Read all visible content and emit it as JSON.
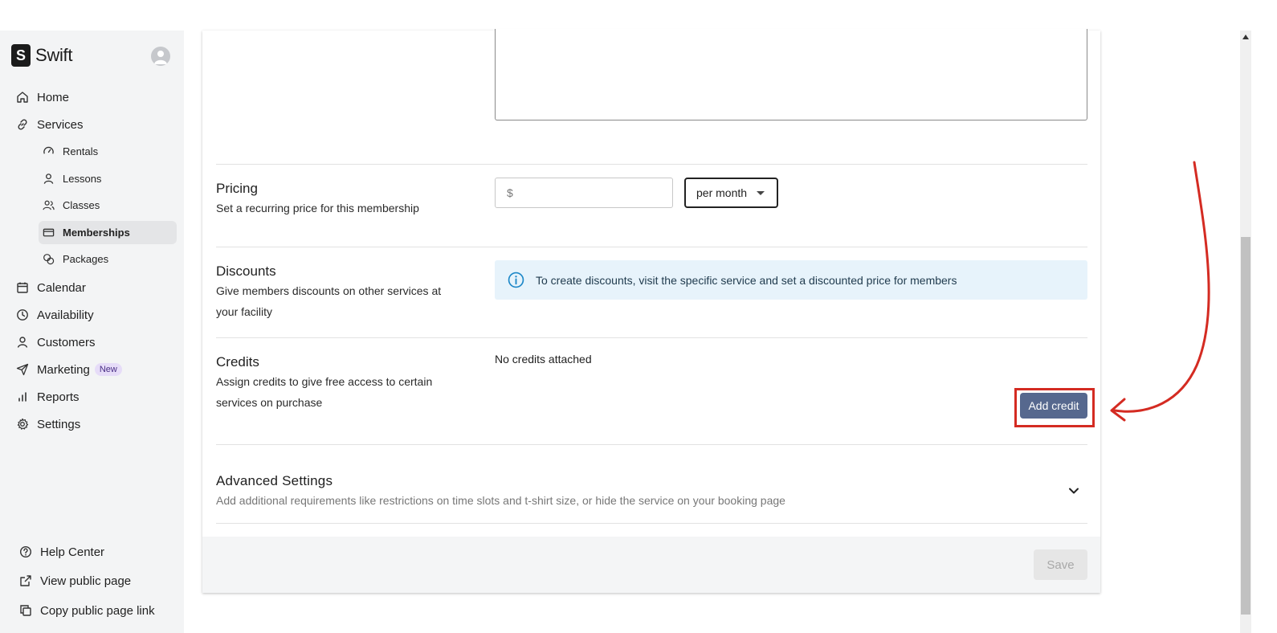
{
  "app": {
    "name": "Swift",
    "logo_letter": "S"
  },
  "sidebar": {
    "items": [
      {
        "label": "Home",
        "icon": "home-icon"
      },
      {
        "label": "Services",
        "icon": "link-icon"
      },
      {
        "label": "Calendar",
        "icon": "calendar-icon"
      },
      {
        "label": "Availability",
        "icon": "clock-icon"
      },
      {
        "label": "Customers",
        "icon": "person-icon"
      },
      {
        "label": "Marketing",
        "icon": "send-icon",
        "badge": "New"
      },
      {
        "label": "Reports",
        "icon": "bar-chart-icon"
      },
      {
        "label": "Settings",
        "icon": "gear-icon"
      }
    ],
    "services_sub": [
      {
        "label": "Rentals",
        "icon": "gauge-icon"
      },
      {
        "label": "Lessons",
        "icon": "person-icon"
      },
      {
        "label": "Classes",
        "icon": "people-icon"
      },
      {
        "label": "Memberships",
        "icon": "card-icon",
        "active": true
      },
      {
        "label": "Packages",
        "icon": "coins-icon"
      }
    ],
    "bottom": [
      {
        "label": "Help Center",
        "icon": "help-circle-icon"
      },
      {
        "label": "View public page",
        "icon": "external-link-icon"
      },
      {
        "label": "Copy public page link",
        "icon": "copy-icon"
      }
    ]
  },
  "form": {
    "pricing": {
      "title": "Pricing",
      "description": "Set a recurring price for this membership",
      "currency_symbol": "$",
      "period": "per month"
    },
    "discounts": {
      "title": "Discounts",
      "description": "Give members discounts on other services at your facility",
      "info": "To create discounts, visit the specific service and set a discounted price for members"
    },
    "credits": {
      "title": "Credits",
      "description": "Assign credits to give free access to certain services on purchase",
      "empty_text": "No credits attached",
      "add_button": "Add credit"
    },
    "advanced": {
      "title": "Advanced Settings",
      "description": "Add additional requirements like restrictions on time slots and t-shirt size, or hide the service on your booking page"
    },
    "save_button": "Save"
  },
  "colors": {
    "accent_button": "#56688e",
    "annotation_red": "#d42b22",
    "info_bg": "#e7f3fb",
    "sidebar_bg": "#f3f4f5"
  }
}
